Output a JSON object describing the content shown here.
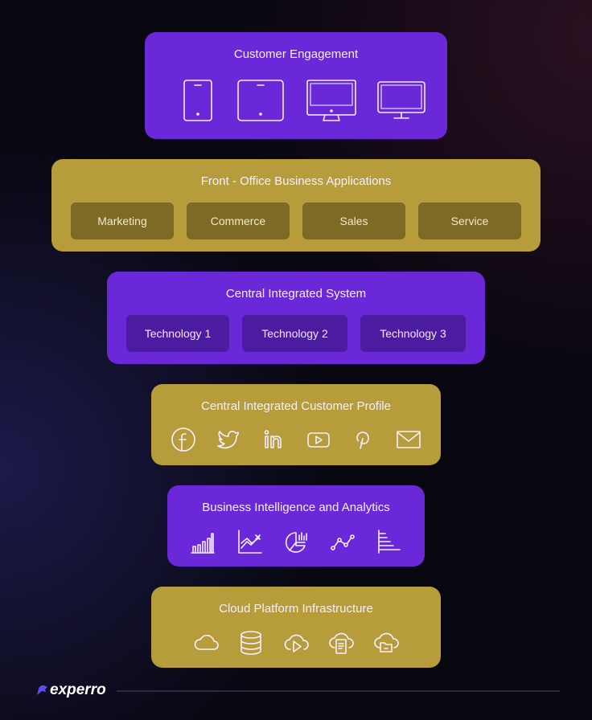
{
  "layers": {
    "customer_engagement": {
      "title": "Customer  Engagement",
      "icons": [
        "smartphone-icon",
        "tablet-icon",
        "desktop-icon",
        "monitor-icon"
      ]
    },
    "front_office": {
      "title": "Front - Office Business Applications",
      "items": [
        "Marketing",
        "Commerce",
        "Sales",
        "Service"
      ]
    },
    "central_system": {
      "title": "Central Integrated System",
      "items": [
        "Technology 1",
        "Technology 2",
        "Technology 3"
      ]
    },
    "customer_profile": {
      "title": "Central Integrated Customer Profile",
      "icons": [
        "facebook-icon",
        "twitter-icon",
        "linkedin-icon",
        "youtube-icon",
        "pinterest-icon",
        "email-icon"
      ]
    },
    "bi_analytics": {
      "title": "Business Intelligence and Analytics",
      "icons": [
        "bar-chart-icon",
        "line-chart-icon",
        "pie-chart-icon",
        "scatter-line-icon",
        "horizontal-bar-icon"
      ]
    },
    "cloud": {
      "title": "Cloud Platform Infrastructure",
      "icons": [
        "cloud-icon",
        "database-icon",
        "cloud-video-icon",
        "cloud-document-icon",
        "cloud-folder-icon"
      ]
    }
  },
  "footer": {
    "brand": "experro"
  },
  "colors": {
    "purple": "#6a28d8",
    "gold": "#b79c3c",
    "background": "#08070f"
  }
}
